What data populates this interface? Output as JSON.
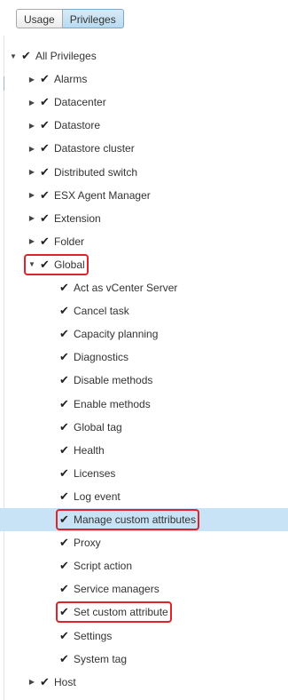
{
  "tabs": {
    "usage": "Usage",
    "privileges": "Privileges"
  },
  "tree": {
    "root": {
      "label": "All Privileges",
      "expanded": true,
      "checked": true
    },
    "categories": [
      {
        "label": "Alarms",
        "expanded": false
      },
      {
        "label": "Datacenter",
        "expanded": false
      },
      {
        "label": "Datastore",
        "expanded": false
      },
      {
        "label": "Datastore cluster",
        "expanded": false
      },
      {
        "label": "Distributed switch",
        "expanded": false
      },
      {
        "label": "ESX Agent Manager",
        "expanded": false
      },
      {
        "label": "Extension",
        "expanded": false
      },
      {
        "label": "Folder",
        "expanded": false
      },
      {
        "label": "Global",
        "expanded": true
      },
      {
        "label": "Host",
        "expanded": false
      }
    ],
    "global_children": [
      "Act as vCenter Server",
      "Cancel task",
      "Capacity planning",
      "Diagnostics",
      "Disable methods",
      "Enable methods",
      "Global tag",
      "Health",
      "Licenses",
      "Log event",
      "Manage custom attributes",
      "Proxy",
      "Script action",
      "Service managers",
      "Set custom attribute",
      "Settings",
      "System tag"
    ],
    "selected_item": "Manage custom attributes",
    "highlighted_items": [
      "Global",
      "Manage custom attributes",
      "Set custom attribute"
    ]
  },
  "icons": {
    "expanded_caret": "caret-down-icon",
    "collapsed_caret": "caret-right-icon",
    "check": "checkmark-icon"
  },
  "colors": {
    "selected_row": "#c8e2f6",
    "highlight_box": "#e0232b",
    "active_tab": "#b9daf0"
  }
}
